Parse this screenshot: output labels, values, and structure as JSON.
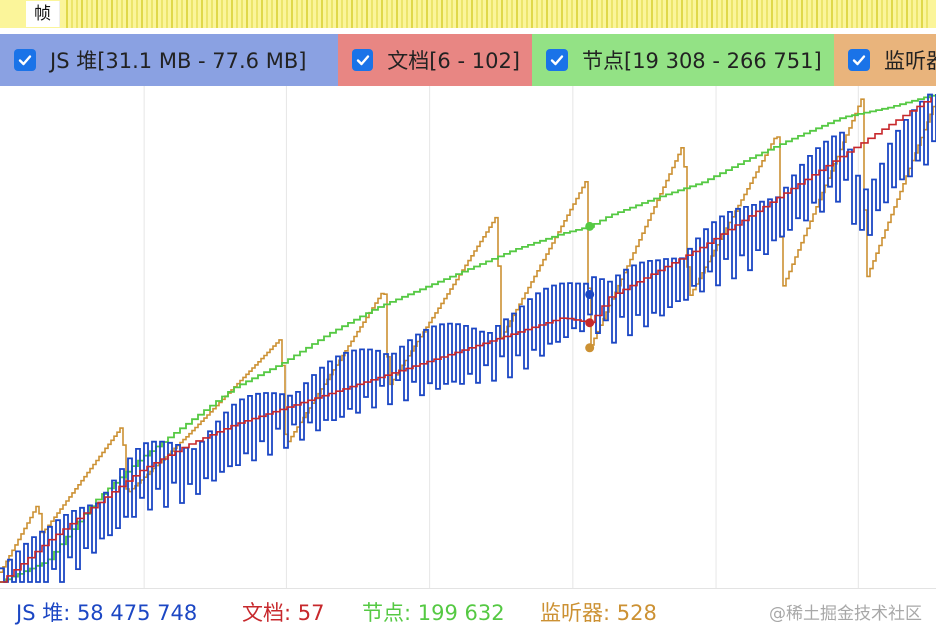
{
  "frames": {
    "label": "帧"
  },
  "legend": [
    {
      "id": "js_heap",
      "label": "JS 堆[31.1 MB - 77.6 MB]",
      "checked": true,
      "bg": "#8aa1e2"
    },
    {
      "id": "documents",
      "label": "文档[6 - 102]",
      "checked": true,
      "bg": "#e88683"
    },
    {
      "id": "nodes",
      "label": "节点[19 308 - 266 751]",
      "checked": true,
      "bg": "#93e285"
    },
    {
      "id": "listeners",
      "label": "监听器",
      "checked": true,
      "bg": "#e9b47c"
    }
  ],
  "readouts": {
    "js_heap": "JS 堆: 58 475 748",
    "documents": "文档: 57",
    "nodes": "节点: 199 632",
    "listeners": "监听器: 528"
  },
  "watermark": "@稀土掘金技术社区",
  "colors": {
    "js_heap": "#1c47c4",
    "documents": "#c7282c",
    "nodes": "#55c943",
    "listeners": "#cc9133",
    "frames": "#fbf59a",
    "checkbox": "#1a73e8"
  },
  "chart_data": {
    "type": "line",
    "x_domain": [
      0,
      100
    ],
    "grid": "vertical-only",
    "legend_position": "top",
    "series": [
      {
        "name": "JS 堆",
        "color": "#1c47c4",
        "ylim": [
          31.1,
          77.6
        ],
        "unit": "MB",
        "x": [
          0,
          5,
          10,
          15,
          20,
          25,
          30,
          35,
          40,
          45,
          50,
          55,
          60,
          63,
          65,
          70,
          75,
          80,
          85,
          90,
          92,
          95,
          100
        ],
        "values": [
          31.1,
          33,
          37,
          41,
          42,
          45,
          47,
          49,
          51,
          52,
          53,
          54,
          57,
          58.5,
          57,
          59,
          62,
          64,
          68,
          71,
          66,
          71,
          75
        ]
      },
      {
        "name": "文档",
        "color": "#c7282c",
        "ylim": [
          6,
          102
        ],
        "x": [
          0,
          5,
          10,
          15,
          20,
          25,
          30,
          35,
          40,
          45,
          50,
          55,
          60,
          63,
          65,
          70,
          75,
          80,
          85,
          90,
          95,
          100
        ],
        "values": [
          6,
          14,
          21,
          28,
          33,
          37,
          40,
          43,
          46,
          49,
          52,
          55,
          58,
          57,
          62,
          67,
          72,
          78,
          84,
          90,
          96,
          102
        ]
      },
      {
        "name": "节点",
        "color": "#55c943",
        "ylim": [
          19308,
          266751
        ],
        "x": [
          0,
          5,
          10,
          15,
          20,
          25,
          30,
          35,
          40,
          45,
          50,
          55,
          60,
          63,
          65,
          70,
          75,
          80,
          85,
          90,
          95,
          100
        ],
        "values": [
          19308,
          30000,
          60000,
          82000,
          100000,
          118000,
          130000,
          145000,
          158000,
          168000,
          178000,
          188000,
          196000,
          199632,
          205000,
          214000,
          222000,
          234000,
          245000,
          255000,
          260000,
          266751
        ]
      },
      {
        "name": "监听器",
        "color": "#cc9133",
        "ylim": [
          0,
          100
        ],
        "x": [
          0,
          4,
          4.5,
          13,
          13.5,
          20,
          30,
          30.5,
          41,
          41.5,
          53,
          53.5,
          62.5,
          63,
          73,
          73.5,
          83,
          83.5,
          92,
          92.5,
          100
        ],
        "values": [
          2,
          16,
          10,
          32,
          18,
          30,
          50,
          28,
          60,
          40,
          75,
          50,
          82,
          48,
          90,
          58,
          92,
          60,
          99,
          62,
          99
        ]
      }
    ]
  }
}
